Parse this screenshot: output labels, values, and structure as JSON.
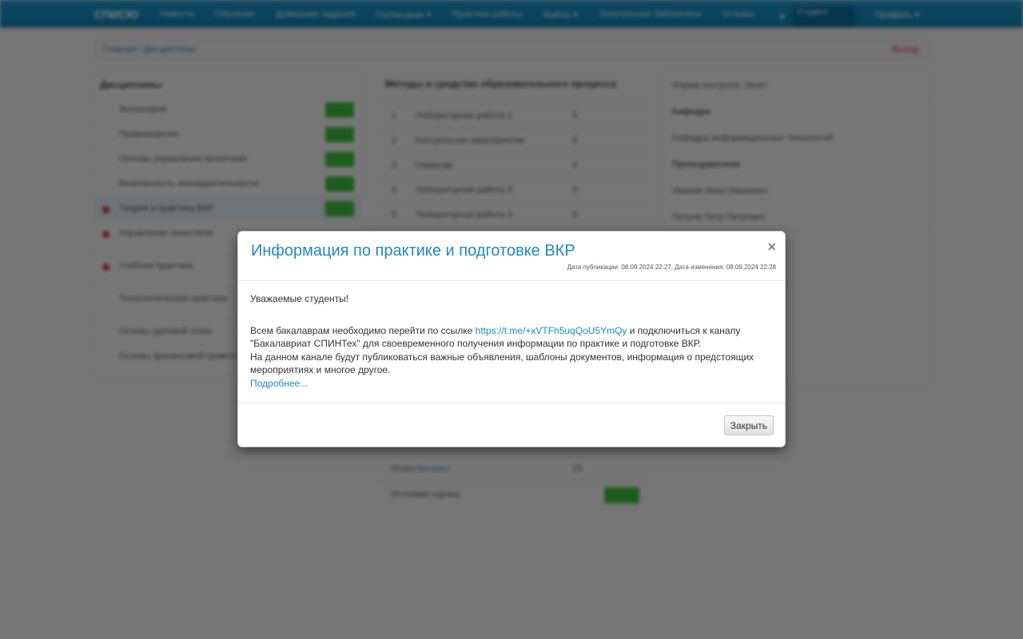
{
  "navbar": {
    "brand": "СПИСЮ",
    "items": [
      "Новости",
      "Обучение",
      "Домашние задания",
      "Расписание ▾",
      "Практика работы",
      "Файлы ▾",
      "Электронная библиотека",
      "Отзывы"
    ],
    "user_label": "Студент",
    "menu_right": "Профиль ▾"
  },
  "breadcrumb": {
    "path": "Главная / Дисциплины",
    "right": "Выход"
  },
  "left_panel": {
    "title": "Дисциплины",
    "rows": [
      "Философия",
      "Правоведение",
      "Основы управления проектами",
      "Безопасность жизнедеятельности",
      "Теория и практика ВКР",
      "Управление качеством",
      "Учебная практика",
      "Технологическая практика",
      "Основы деловой этики",
      "Основы финансовой грамотности"
    ]
  },
  "middle_panel": {
    "title": "Методы и средства образовательного процесса",
    "rows": [
      {
        "n": "1",
        "t": "Лабораторная работа 1",
        "v": "5"
      },
      {
        "n": "2",
        "t": "Контрольное мероприятие",
        "v": "5"
      },
      {
        "n": "3",
        "t": "Семинар",
        "v": "4"
      },
      {
        "n": "4",
        "t": "Лабораторная работа 2",
        "v": "5"
      },
      {
        "n": "5",
        "t": "Лабораторная работа 3",
        "v": "5"
      }
    ],
    "total_label": "Итого",
    "total_link": "Зачтено",
    "total_value": "25",
    "final_label": "Итоговая оценка"
  },
  "right_panel": {
    "rows": [
      "Форма контроля: Зачёт",
      "Кафедра",
      "Кафедра информационных технологий",
      "Преподаватели",
      "Иванов Иван Иванович",
      "Петров Петр Петрович"
    ]
  },
  "modal": {
    "title": "Информация по практике и подготовке ВКР",
    "meta": "Дата публикации: 08.09.2024 22:27, Дата изменения: 08.09.2024 22:28",
    "close_symbol": "×",
    "greeting": "Уважаемые студенты!",
    "text_before_link": "Всем бакалаврам необходимо перейти по ссылке ",
    "link": "https://t.me/+xVTFh5uqQoU5YmQy",
    "text_after_link": " и подключиться к каналу \"Бакалавриат СПИНТех\" для своевременного получения информации по практике и подготовке ВКР.",
    "line3": "На данном канале будут публиковаться важные объявления, шаблоны документов, информация о предстоящих мероприятиях и многое другое.",
    "more_link": "Подробнее...",
    "close_button": "Закрыть"
  }
}
